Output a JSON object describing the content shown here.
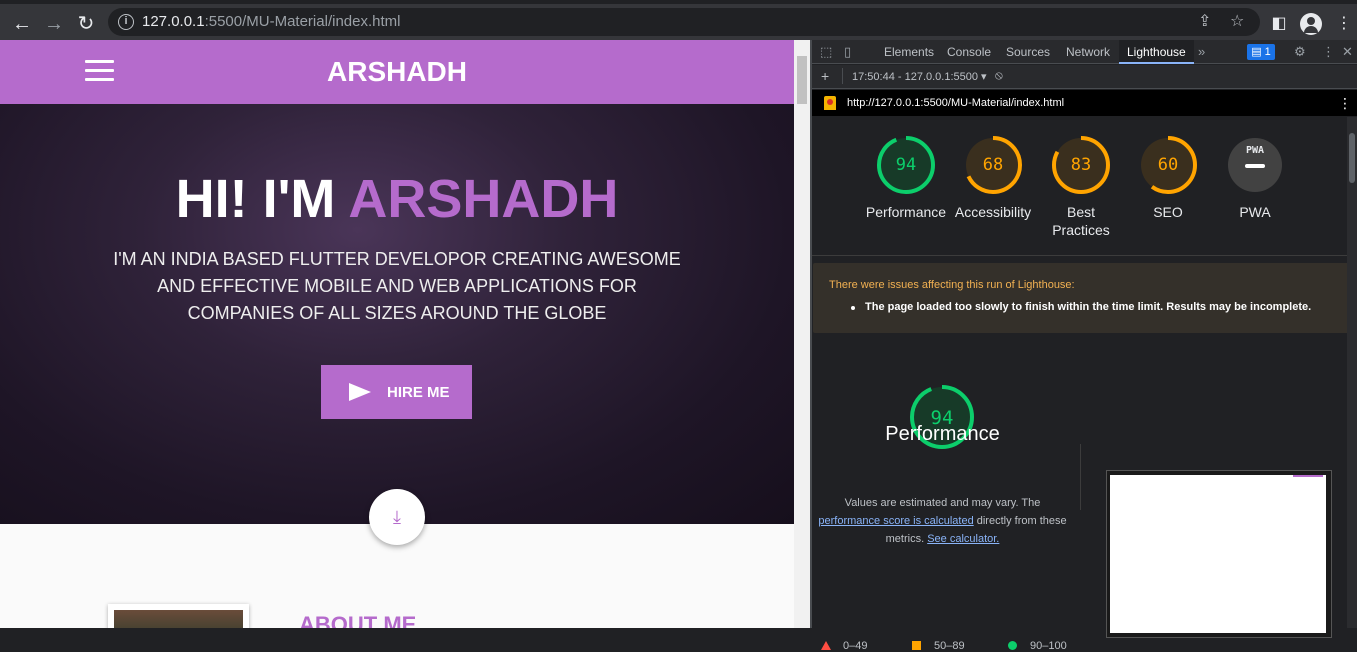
{
  "browser": {
    "url_host": "127.0.0.1",
    "url_rest": ":5500/MU-Material/index.html"
  },
  "site": {
    "brand": "ARSHADH",
    "hero_title_prefix": "HI! I'M ",
    "hero_title_name": "ARSHADH",
    "hero_subtitle": "I'M AN INDIA BASED FLUTTER DEVELOPOR CREATING AWESOME AND EFFECTIVE MOBILE AND WEB APPLICATIONS FOR COMPANIES OF ALL SIZES AROUND THE GLOBE",
    "hire_button": "HIRE ME",
    "about_title": "ABOUT ME",
    "accent_color": "#b56bcc"
  },
  "devtools": {
    "tabs": [
      "Elements",
      "Console",
      "Sources",
      "Network",
      "Lighthouse"
    ],
    "active_tab": "Lighthouse",
    "issues_badge": "1",
    "report_selector": "17:50:44 - 127.0.0.1:5500",
    "report_url": "http://127.0.0.1:5500/MU-Material/index.html",
    "scores": [
      {
        "name": "Performance",
        "value": "94",
        "fraction": 0.94,
        "color": "#0cce6b"
      },
      {
        "name": "Accessibility",
        "value": "68",
        "fraction": 0.68,
        "color": "#ffa400"
      },
      {
        "name": "Best Practices",
        "value": "83",
        "fraction": 0.83,
        "color": "#ffa400"
      },
      {
        "name": "SEO",
        "value": "60",
        "fraction": 0.6,
        "color": "#ffa400"
      },
      {
        "name": "PWA",
        "value": "PWA",
        "fraction": 0,
        "color": "#9aa0a6"
      }
    ],
    "warning_title": "There were issues affecting this run of Lighthouse:",
    "warning_item": "The page loaded too slowly to finish within the time limit. Results may be incomplete.",
    "performance": {
      "score": "94",
      "fraction": 0.94,
      "title": "Performance",
      "desc_1": "Values are estimated and may vary. The",
      "link_1": "performance score is calculated",
      "desc_2": " directly from these",
      "desc_3": "metrics. ",
      "link_2": "See calculator."
    },
    "legend": [
      "0–49",
      "50–89",
      "90–100"
    ]
  }
}
